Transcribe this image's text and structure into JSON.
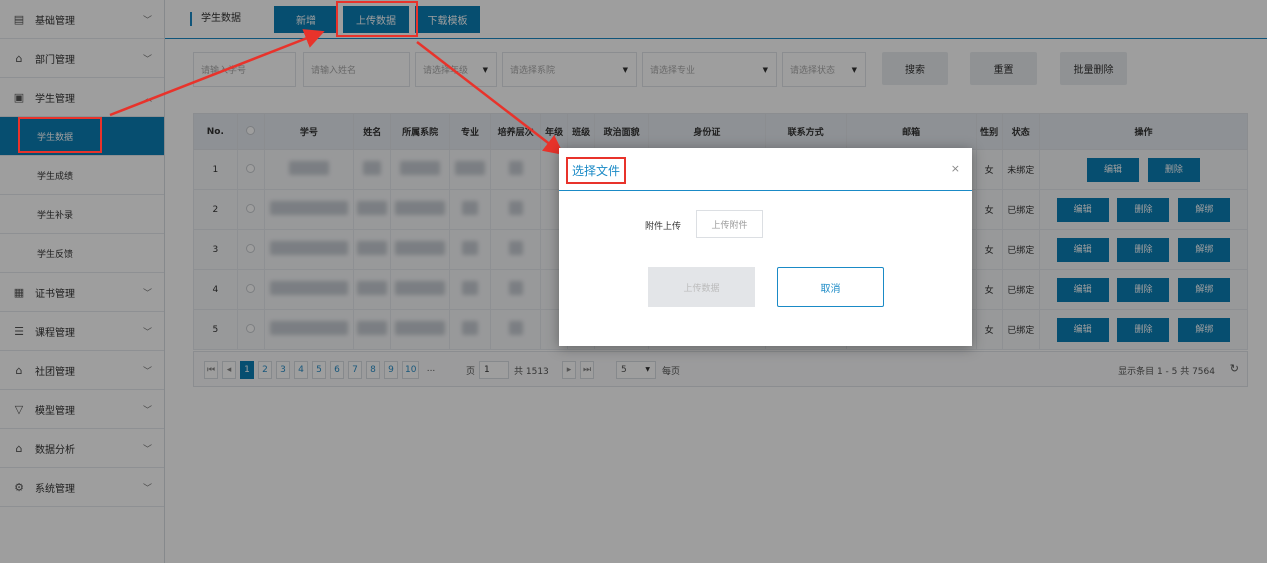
{
  "sidebar": {
    "items": [
      {
        "label": "基础管理"
      },
      {
        "label": "部门管理"
      },
      {
        "label": "学生管理"
      },
      {
        "label": "证书管理"
      },
      {
        "label": "课程管理"
      },
      {
        "label": "社团管理"
      },
      {
        "label": "模型管理"
      },
      {
        "label": "数据分析"
      },
      {
        "label": "系统管理"
      }
    ],
    "sub_items": [
      {
        "label": "学生数据"
      },
      {
        "label": "学生成绩"
      },
      {
        "label": "学生补录"
      },
      {
        "label": "学生反馈"
      }
    ]
  },
  "topbar": {
    "breadcrumb": "学生数据",
    "add_label": "新增",
    "upload_label": "上传数据",
    "download_label": "下载模板"
  },
  "filters": {
    "student_id_placeholder": "请输入学号",
    "name_placeholder": "请输入姓名",
    "grade_placeholder": "请选择年级",
    "department_placeholder": "请选择系院",
    "major_placeholder": "请选择专业",
    "status_placeholder": "请选择状态",
    "search_label": "搜索",
    "reset_label": "重置",
    "batch_delete_label": "批量删除"
  },
  "table": {
    "headers": [
      "No.",
      "学号",
      "姓名",
      "所属系院",
      "专业",
      "培养层次",
      "年级",
      "班级",
      "政治面貌",
      "身份证",
      "联系方式",
      "邮箱",
      "性别",
      "状态",
      "操作"
    ],
    "rows": [
      {
        "no": "1",
        "gender": "女",
        "status": "未绑定"
      },
      {
        "no": "2",
        "gender": "女",
        "status": "已绑定"
      },
      {
        "no": "3",
        "gender": "女",
        "status": "已绑定"
      },
      {
        "no": "4",
        "gender": "女",
        "status": "已绑定"
      },
      {
        "no": "5",
        "gender": "女",
        "status": "已绑定"
      }
    ],
    "edit_label": "编辑",
    "delete_label": "删除",
    "unbind_label": "解绑"
  },
  "pager": {
    "pages": [
      "1",
      "2",
      "3",
      "4",
      "5",
      "6",
      "7",
      "8",
      "9",
      "10",
      "..."
    ],
    "page_prefix": "页",
    "current_page": "1",
    "total_pages_text": "共 1513",
    "page_size": "5",
    "per_page_label": "每页",
    "summary": "显示条目 1 - 5 共 7564"
  },
  "modal": {
    "title": "选择文件",
    "attach_label": "附件上传",
    "attach_button": "上传附件",
    "upload_button": "上传数据",
    "cancel_button": "取消"
  }
}
